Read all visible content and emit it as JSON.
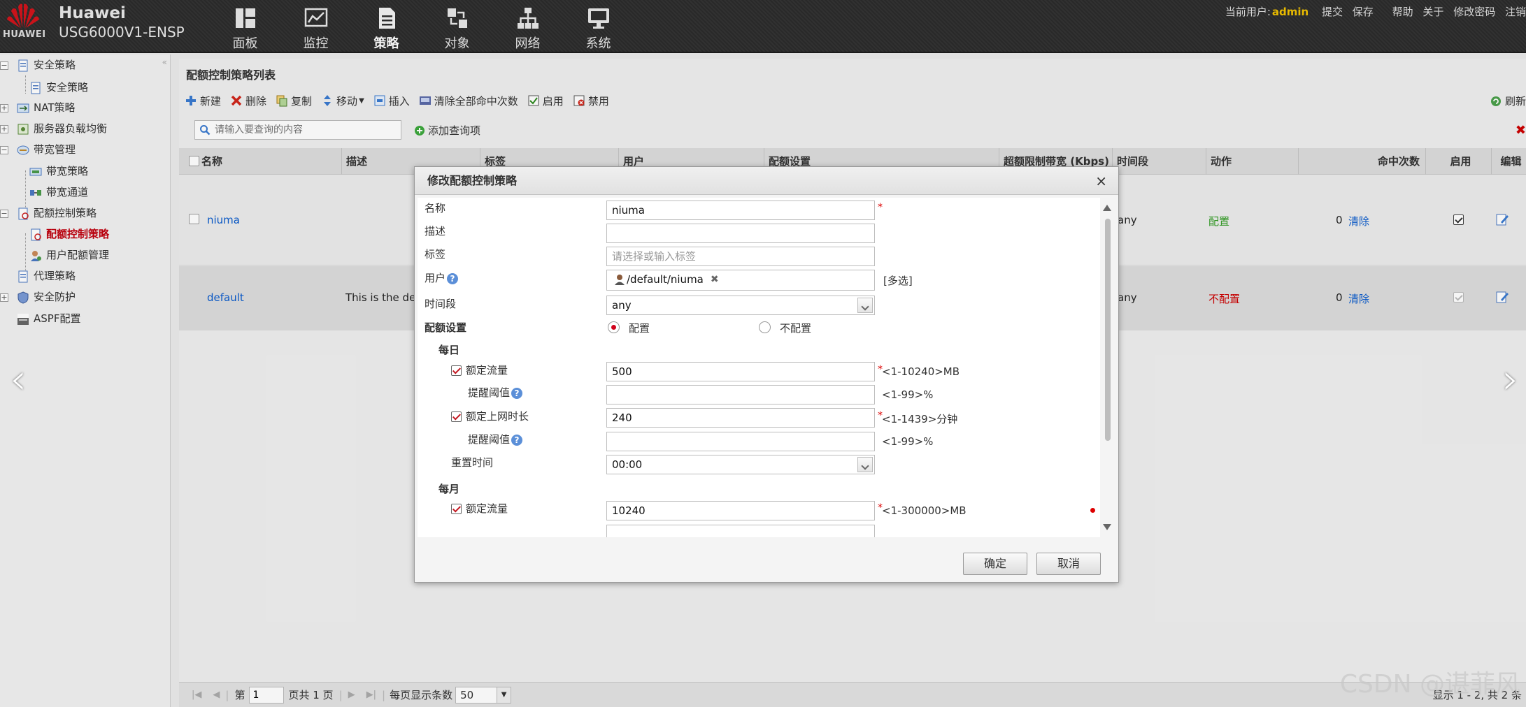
{
  "brand": {
    "logo_word": "HUAWEI",
    "name": "Huawei",
    "model": "USG6000V1-ENSP"
  },
  "nav": [
    {
      "label": "面板",
      "icon": "dashboard-icon"
    },
    {
      "label": "监控",
      "icon": "monitor-icon"
    },
    {
      "label": "策略",
      "icon": "policy-icon"
    },
    {
      "label": "对象",
      "icon": "object-icon"
    },
    {
      "label": "网络",
      "icon": "network-icon"
    },
    {
      "label": "系统",
      "icon": "system-icon"
    }
  ],
  "topbar": {
    "user_label": "当前用户:",
    "user": "admin",
    "submit": "提交",
    "save": "保存",
    "help": "帮助",
    "about": "关于",
    "change_pwd": "修改密码",
    "logout": "注销"
  },
  "sidebar": {
    "items": [
      {
        "label": "安全策略",
        "toggle": "−"
      },
      {
        "label": "安全策略"
      },
      {
        "label": "NAT策略",
        "toggle": "+"
      },
      {
        "label": "服务器负载均衡",
        "toggle": "+"
      },
      {
        "label": "带宽管理",
        "toggle": "−"
      },
      {
        "label": "带宽策略"
      },
      {
        "label": "带宽通道"
      },
      {
        "label": "配额控制策略",
        "toggle": "−"
      },
      {
        "label": "配额控制策略"
      },
      {
        "label": "用户配额管理"
      },
      {
        "label": "代理策略"
      },
      {
        "label": "安全防护",
        "toggle": "+"
      },
      {
        "label": "ASPF配置"
      }
    ]
  },
  "main": {
    "title": "配额控制策略列表",
    "toolbar": {
      "new": "新建",
      "delete": "删除",
      "copy": "复制",
      "move": "移动",
      "insert": "插入",
      "clear_hits": "清除全部命中次数",
      "enable": "启用",
      "disable": "禁用",
      "refresh": "刷新"
    },
    "search_placeholder": "请输入要查询的内容",
    "add_query": "添加查询项",
    "columns": [
      "名称",
      "描述",
      "标签",
      "用户",
      "配额设置",
      "超额限制带宽 (Kbps)",
      "时间段",
      "动作",
      "命中次数",
      "启用",
      "编辑"
    ],
    "rows": [
      {
        "name": "niuma",
        "desc": "",
        "time": "any",
        "action": "配置",
        "hits": "0",
        "clear": "清除"
      },
      {
        "name": "default",
        "desc": "This is the def",
        "time": "any",
        "action": "不配置",
        "hits": "0",
        "clear": "清除"
      }
    ],
    "pager": {
      "page_prefix": "第",
      "page": "1",
      "total_pages": "页共 1 页",
      "per_page_label": "每页显示条数",
      "per_page": "50",
      "info": "显示 1 - 2, 共 2 条"
    }
  },
  "dialog": {
    "title": "修改配额控制策略",
    "close": "×",
    "fields": {
      "name_label": "名称",
      "name_value": "niuma",
      "desc_label": "描述",
      "desc_value": "",
      "tag_label": "标签",
      "tag_placeholder": "请选择或输入标签",
      "user_label": "用户",
      "user_value": "/default/niuma",
      "user_multi": "[多选]",
      "time_label": "时间段",
      "time_value": "any",
      "quota_label": "配额设置",
      "quota_on": "配置",
      "quota_off": "不配置",
      "daily": "每日",
      "daily_traffic_label": "额定流量",
      "daily_traffic_value": "500",
      "daily_traffic_hint": "<1-10240>MB",
      "daily_traffic_alert_label": "提醒阈值",
      "daily_traffic_alert_hint": "<1-99>%",
      "daily_online_label": "额定上网时长",
      "daily_online_value": "240",
      "daily_online_hint": "<1-1439>分钟",
      "daily_online_alert_label": "提醒阈值",
      "daily_online_alert_hint": "<1-99>%",
      "reset_label": "重置时间",
      "reset_value": "00:00",
      "monthly": "每月",
      "monthly_traffic_label": "额定流量",
      "monthly_traffic_value": "10240",
      "monthly_traffic_hint": "<1-300000>MB"
    },
    "ok": "确定",
    "cancel": "取消"
  },
  "watermark": "CSDN @谌菲风"
}
